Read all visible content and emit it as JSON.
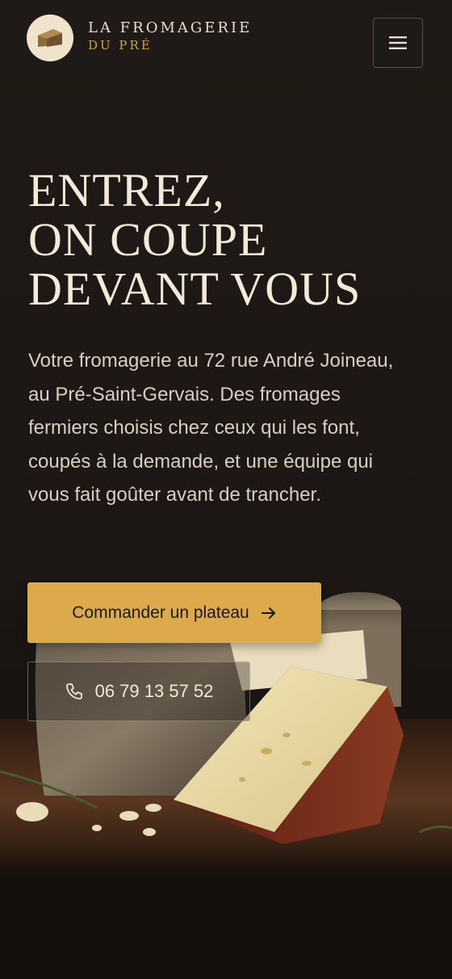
{
  "header": {
    "brand_line1": "LA FROMAGERIE",
    "brand_line2": "DU PRÉ",
    "logo_icon": "cheese-wheel-icon",
    "menu_icon": "hamburger-menu-icon"
  },
  "hero": {
    "title_lines": [
      "ENTREZ,",
      "ON COUPE",
      "DEVANT VOUS"
    ],
    "description": "Votre fromagerie au 72 rue André Joineau, au Pré-Saint-Gervais. Des fromages fermiers choisis chez ceux qui les font, coupés à la demande, et une équipe qui vous fait goûter avant de trancher.",
    "primary_cta": {
      "label": "Commander un plateau",
      "icon": "arrow-right-icon"
    },
    "phone_cta": {
      "label": "06 79 13 57 52",
      "icon": "phone-icon"
    }
  },
  "colors": {
    "background": "#1c1715",
    "accent_gold": "#dcaa4b",
    "brand_gold": "#c9a24d",
    "headline_cream": "#f3ead8"
  }
}
